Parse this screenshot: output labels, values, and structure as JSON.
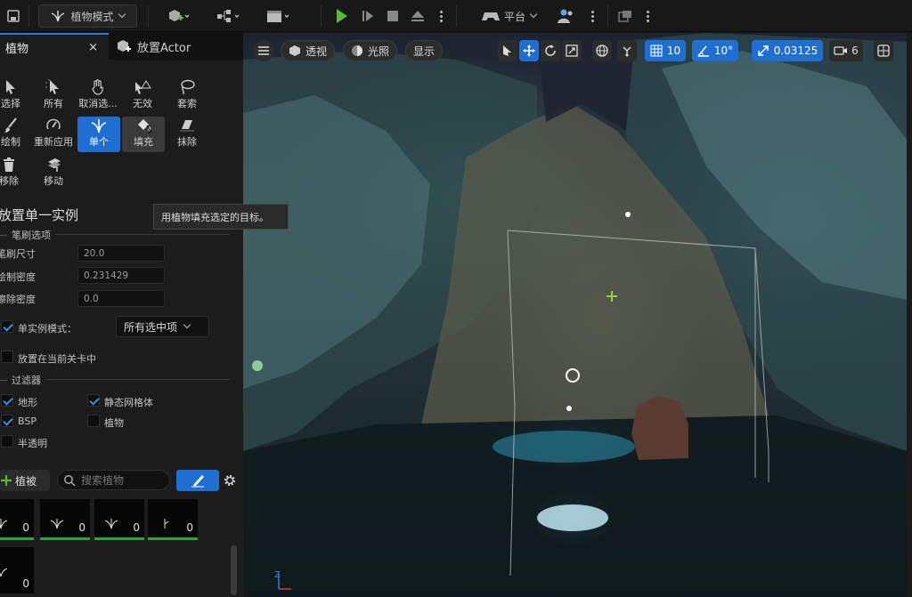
{
  "toolbar": {
    "mode_label": "植物模式",
    "platform_label": "平台"
  },
  "tabs": [
    {
      "label": "植物",
      "close": "×"
    },
    {
      "label": "放置Actor"
    }
  ],
  "tools_row1": [
    "选择",
    "所有",
    "取消选...",
    "无效",
    "套索"
  ],
  "tools_row2": [
    "绘制",
    "重新应用",
    "单个",
    "填充",
    "抹除"
  ],
  "tools_row3": [
    "移除",
    "移动"
  ],
  "tooltip": "用植物填充选定的目标。",
  "section_title": "放置单一实例",
  "brush": {
    "group_label": "笔刷选项",
    "size_label": "笔刷尺寸",
    "size_value": "20.0",
    "paint_density_label": "绘制密度",
    "paint_density_value": "0.231429",
    "erase_density_label": "擦除密度",
    "erase_density_value": "0.0"
  },
  "single_instance": {
    "label": "单实例模式：",
    "checked": true,
    "dropdown_value": "所有选中项"
  },
  "place_current_level": {
    "label": "放置在当前关卡中",
    "checked": false
  },
  "filters": {
    "group_label": "过滤器",
    "items": [
      {
        "label": "地形",
        "checked": true
      },
      {
        "label": "静态网格体",
        "checked": true
      },
      {
        "label": "BSP",
        "checked": true
      },
      {
        "label": "植物",
        "checked": false
      },
      {
        "label": "半透明",
        "checked": false
      }
    ]
  },
  "foliage_bar": {
    "add_label": "植被",
    "search_placeholder": "搜索植物"
  },
  "foliage_items": [
    {
      "count": "0"
    },
    {
      "count": "0"
    },
    {
      "count": "0"
    },
    {
      "count": "0"
    },
    {
      "count": "0"
    }
  ],
  "viewport": {
    "perspective_label": "透视",
    "lit_label": "光照",
    "show_label": "显示",
    "grid_snap": "10",
    "angle_snap": "10°",
    "scale_snap": "0.03125",
    "camera_speed": "6",
    "axis_z": "Z"
  },
  "colors": {
    "accent": "#1f6fd3",
    "play": "#5ab83a",
    "foliage_bar": "#2aa53c"
  }
}
